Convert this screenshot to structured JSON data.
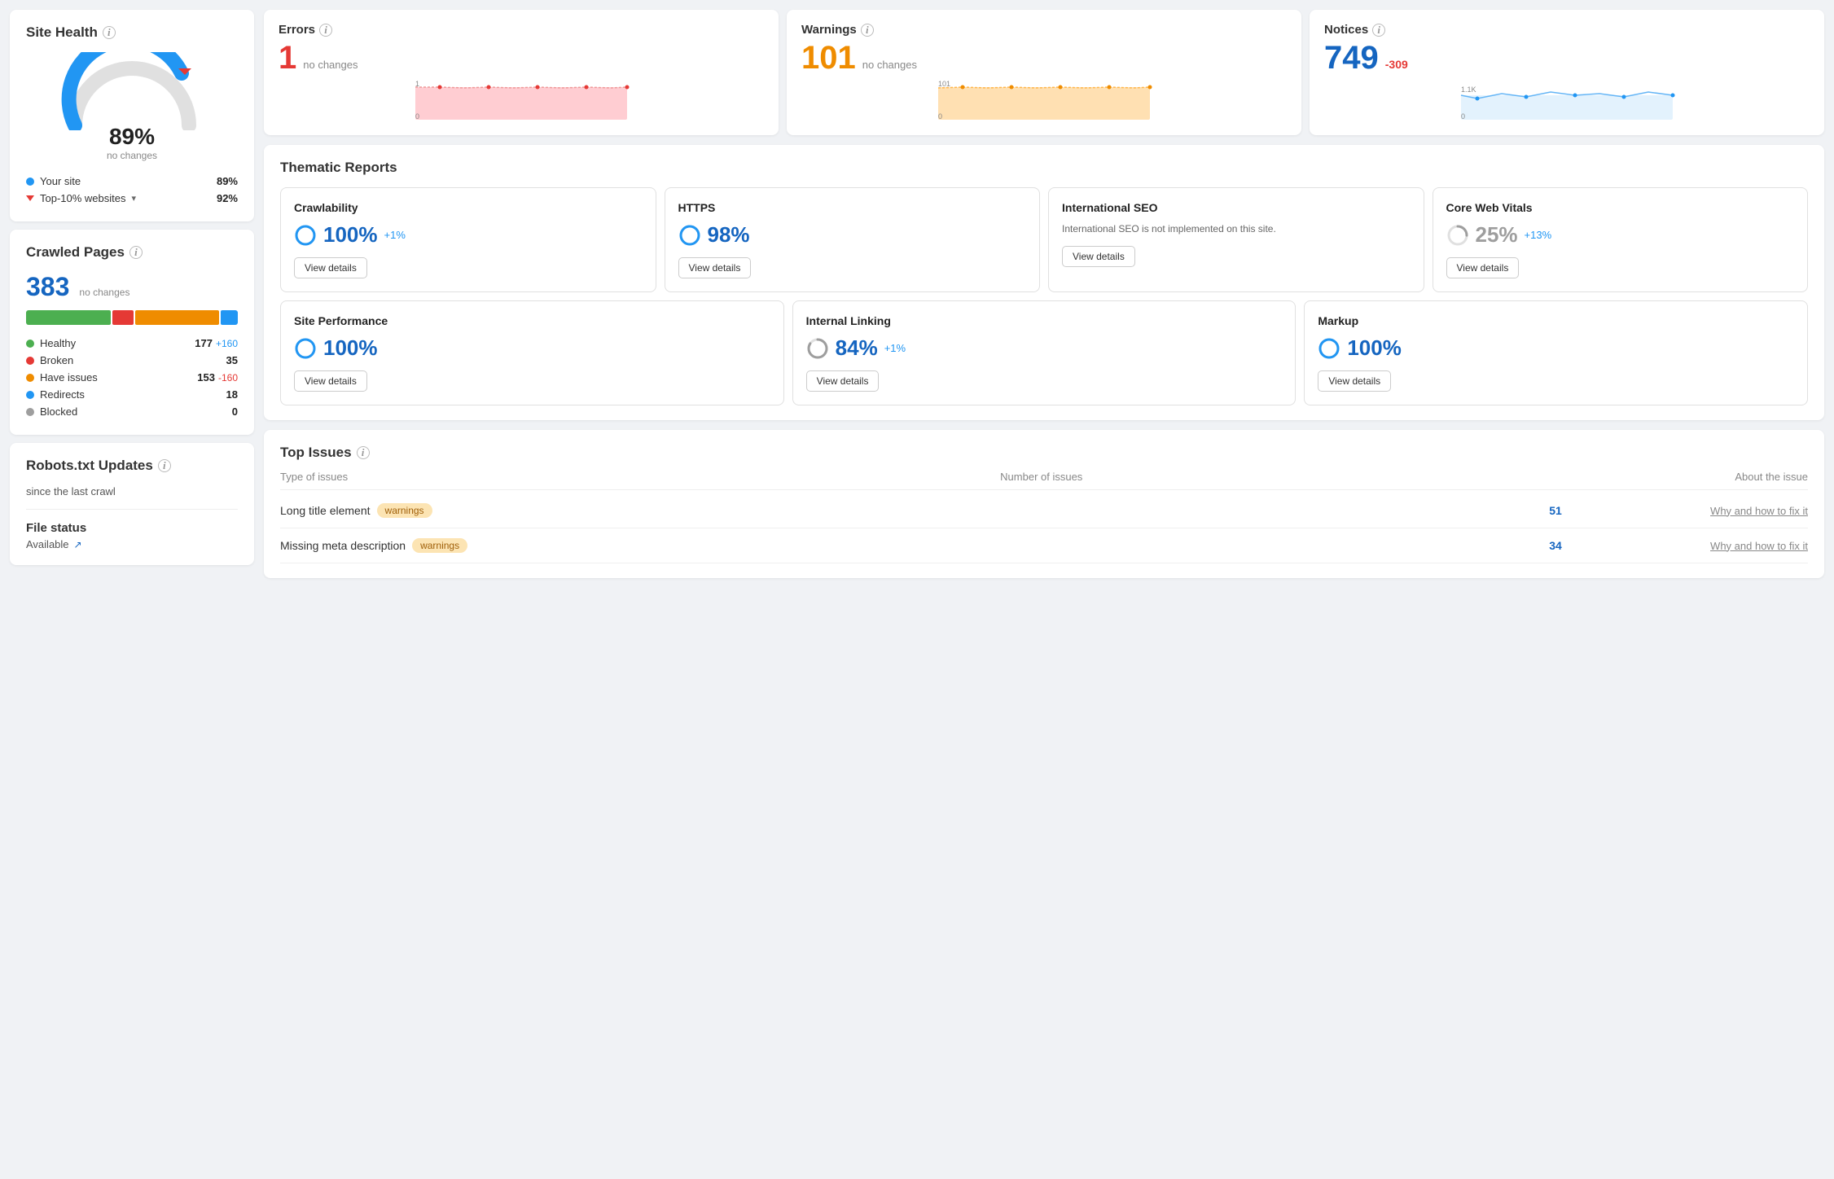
{
  "sidebar": {
    "site_health": {
      "title": "Site Health",
      "info": "i",
      "gauge": {
        "percent": "89%",
        "sub": "no changes",
        "value": 89
      },
      "legend": [
        {
          "label": "Your site",
          "color": "#2196f3",
          "type": "circle",
          "value": "89%",
          "change": null
        },
        {
          "label": "Top-10% websites",
          "color": "#e53935",
          "type": "triangle",
          "value": "92%",
          "change": null
        }
      ]
    },
    "crawled_pages": {
      "title": "Crawled Pages",
      "info": "i",
      "count": "383",
      "sub": "no changes",
      "bars": [
        {
          "color": "#4caf50",
          "width": 40
        },
        {
          "color": "#e53935",
          "width": 10
        },
        {
          "color": "#ef8c00",
          "width": 40
        },
        {
          "color": "#2196f3",
          "width": 8
        }
      ],
      "items": [
        {
          "label": "Healthy",
          "color": "#4caf50",
          "value": "177",
          "change": "+160",
          "change_type": "pos"
        },
        {
          "label": "Broken",
          "color": "#e53935",
          "value": "35",
          "change": null
        },
        {
          "label": "Have issues",
          "color": "#ef8c00",
          "value": "153",
          "change": "-160",
          "change_type": "neg"
        },
        {
          "label": "Redirects",
          "color": "#2196f3",
          "value": "18",
          "change": null
        },
        {
          "label": "Blocked",
          "color": "#9e9e9e",
          "value": "0",
          "change": null
        }
      ]
    },
    "robots": {
      "title": "Robots.txt Updates",
      "info": "i",
      "sub": "since the last crawl"
    },
    "file_status": {
      "title": "File status",
      "value": "Available",
      "icon": "↗"
    }
  },
  "metrics": [
    {
      "label": "Errors",
      "info": "i",
      "value": "1",
      "class": "metric-errors",
      "change": "no changes",
      "change_class": "metric-change",
      "chart_color": "#ffcdd2",
      "line_color": "#ef9a9a",
      "y_top": "1",
      "y_bot": "0"
    },
    {
      "label": "Warnings",
      "info": "i",
      "value": "101",
      "class": "metric-warnings",
      "change": "no changes",
      "change_class": "metric-change",
      "chart_color": "#ffe0b2",
      "line_color": "#ffb74d",
      "y_top": "101",
      "y_bot": "0"
    },
    {
      "label": "Notices",
      "info": "i",
      "value": "749",
      "class": "metric-notices",
      "change": "-309",
      "change_class": "metric-change-neg",
      "chart_color": "#e3f2fd",
      "line_color": "#64b5f6",
      "y_top": "1.1K",
      "y_bot": "0"
    }
  ],
  "thematic_reports": {
    "title": "Thematic Reports",
    "row1": [
      {
        "title": "Crawlability",
        "score": "100%",
        "score_class": "",
        "change": "+1%",
        "has_note": false,
        "circle_color": "#2196f3",
        "btn_label": "View details"
      },
      {
        "title": "HTTPS",
        "score": "98%",
        "score_class": "",
        "change": null,
        "has_note": false,
        "circle_color": "#2196f3",
        "btn_label": "View details"
      },
      {
        "title": "International SEO",
        "score": null,
        "score_class": "",
        "change": null,
        "has_note": true,
        "note": "International SEO is not implemented on this site.",
        "circle_color": "#9e9e9e",
        "btn_label": "View details"
      },
      {
        "title": "Core Web Vitals",
        "score": "25%",
        "score_class": "report-score-gray",
        "change": "+13%",
        "has_note": false,
        "circle_color": "#9e9e9e",
        "btn_label": "View details"
      }
    ],
    "row2": [
      {
        "title": "Site Performance",
        "score": "100%",
        "score_class": "",
        "change": null,
        "has_note": false,
        "circle_color": "#2196f3",
        "btn_label": "View details"
      },
      {
        "title": "Internal Linking",
        "score": "84%",
        "score_class": "",
        "change": "+1%",
        "has_note": false,
        "circle_color": "#9e9e9e",
        "btn_label": "View details"
      },
      {
        "title": "Markup",
        "score": "100%",
        "score_class": "",
        "change": null,
        "has_note": false,
        "circle_color": "#2196f3",
        "btn_label": "View details"
      }
    ]
  },
  "top_issues": {
    "title": "Top Issues",
    "info": "i",
    "col_type": "Type of issues",
    "col_count": "Number of issues",
    "col_about": "About the issue",
    "rows": [
      {
        "type": "Long title element",
        "badge": "warnings",
        "count": "51",
        "about": "Why and how to fix it"
      },
      {
        "type": "Missing meta description",
        "badge": "warnings",
        "count": "34",
        "about": "Why and how to fix it"
      }
    ]
  }
}
